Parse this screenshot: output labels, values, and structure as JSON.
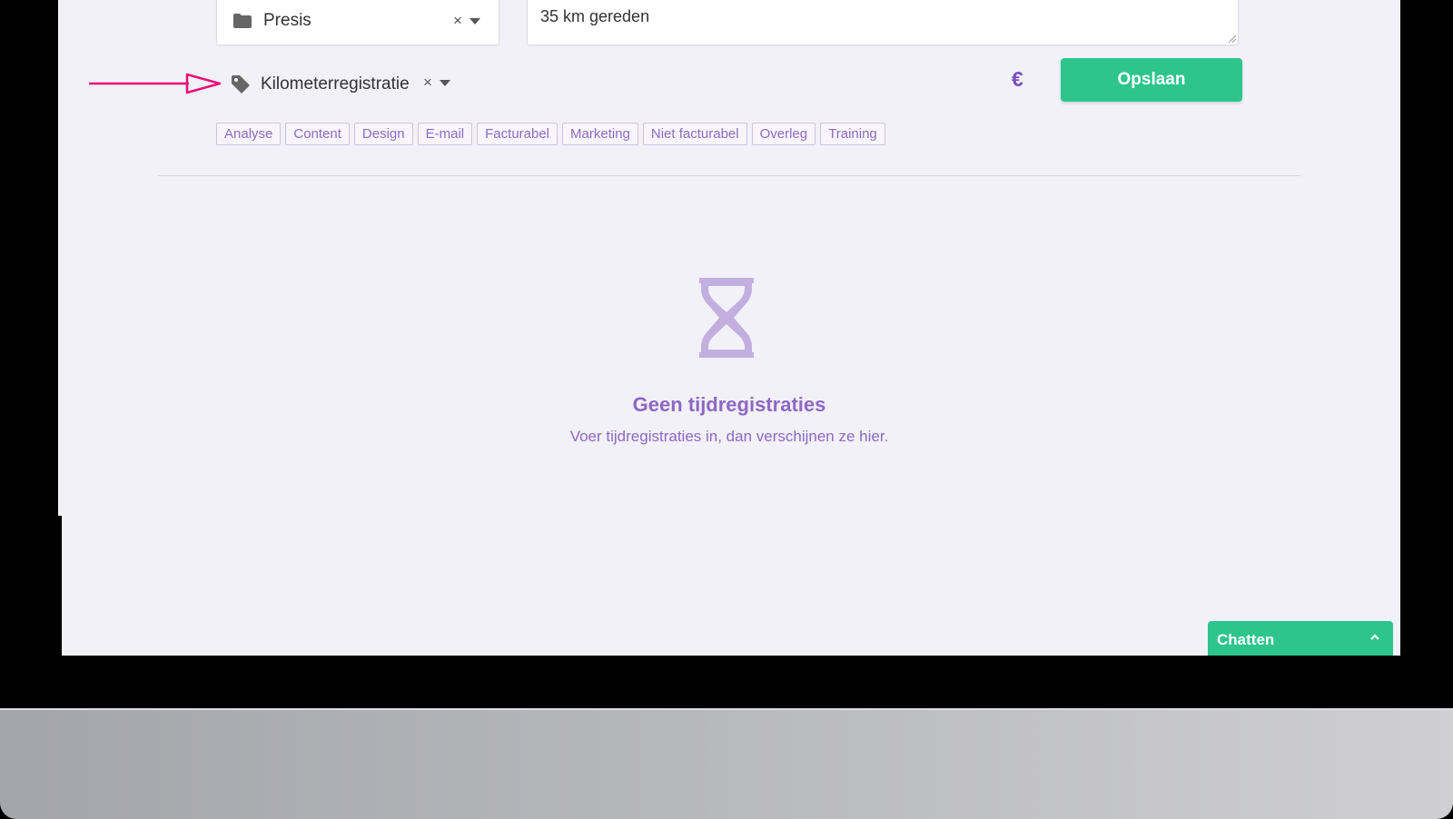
{
  "form": {
    "project_value": "Presis",
    "description_value": "35 km gereden",
    "tag_value": "Kilometerregistratie",
    "clear_glyph": "×",
    "billable_symbol": "€",
    "save_label": "Opslaan"
  },
  "tag_chips": [
    "Analyse",
    "Content",
    "Design",
    "E-mail",
    "Facturabel",
    "Marketing",
    "Niet facturabel",
    "Overleg",
    "Training"
  ],
  "empty_state": {
    "title": "Geen tijdregistraties",
    "subtitle": "Voer tijdregistraties in, dan verschijnen ze hier."
  },
  "chat": {
    "label": "Chatten"
  },
  "colors": {
    "accent_green": "#2ec58c",
    "accent_purple": "#8e68c2",
    "arrow_pink": "#e8107a"
  },
  "icons": [
    "folder-icon",
    "tag-icon",
    "hourglass-icon",
    "chevron-up-icon",
    "caret-down-icon",
    "clear-icon",
    "annotation-arrow"
  ]
}
